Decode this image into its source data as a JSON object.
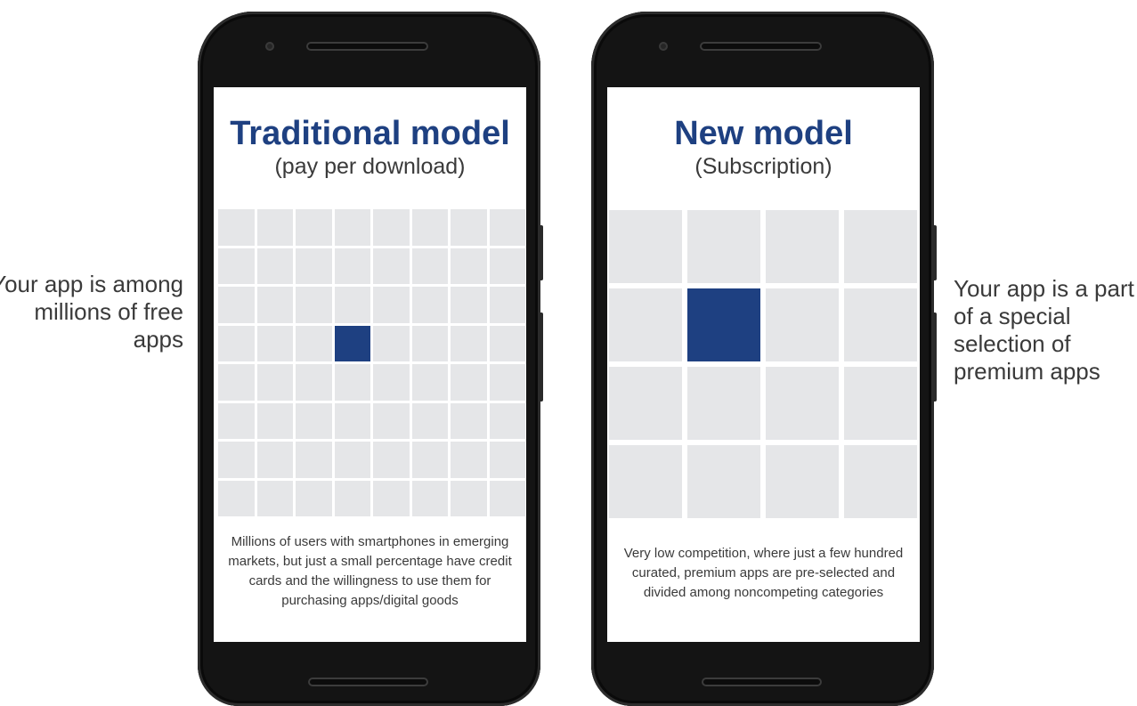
{
  "captions": {
    "left": "Your app is among millions of free apps",
    "right": "Your app is a part of a special selection of premium apps"
  },
  "traditional": {
    "title": "Traditional model",
    "subtitle": "(pay per download)",
    "grid": {
      "rows": 8,
      "cols": 8,
      "highlight": [
        3,
        3
      ]
    },
    "note": "Millions of users with smartphones in emerging markets, but just a small percentage have credit cards and the willingness to use them for purchasing apps/digital goods"
  },
  "subscription": {
    "title": "New model",
    "subtitle": "(Subscription)",
    "grid": {
      "rows": 4,
      "cols": 4,
      "highlight": [
        1,
        1
      ]
    },
    "note": "Very low competition, where just a few hundred curated, premium apps are pre-selected and divided among noncompeting categories"
  },
  "colors": {
    "accent": "#1e4081",
    "tile": "#e5e6e8",
    "phone_body": "#141414"
  }
}
